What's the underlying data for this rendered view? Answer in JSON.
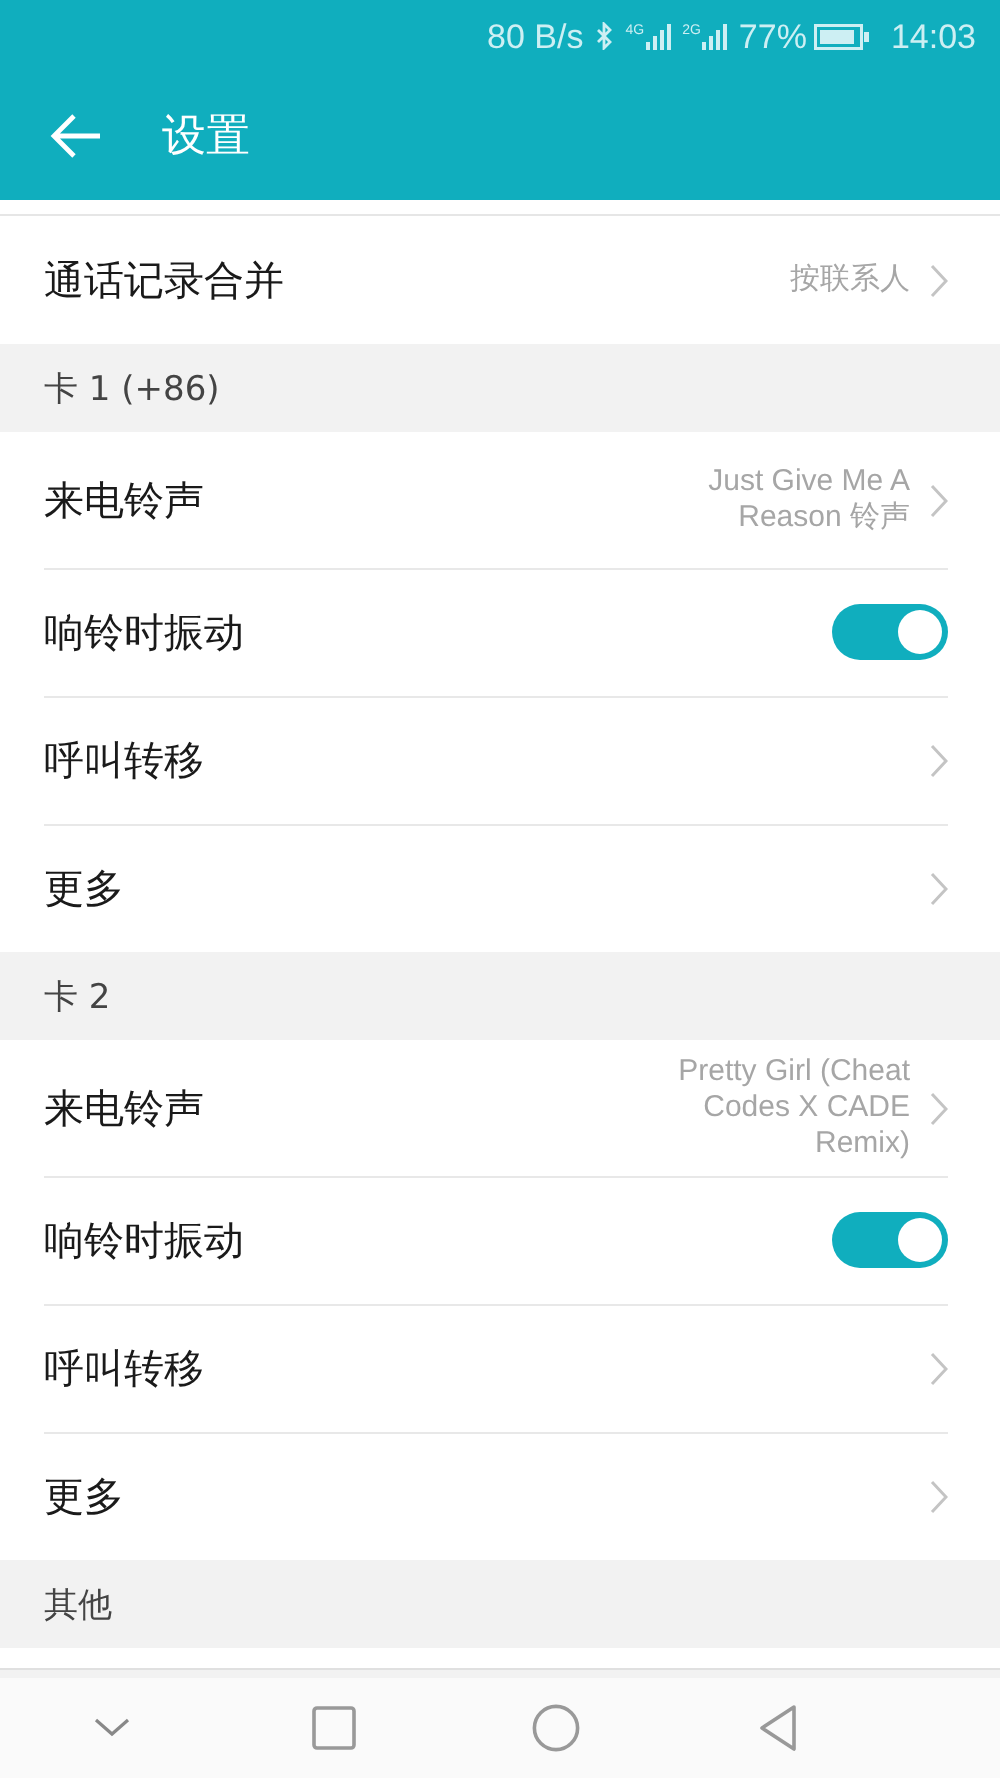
{
  "status_bar": {
    "speed": "80 B/s",
    "sim1_network": "4G",
    "sim2_network": "2G",
    "battery": "77%",
    "time": "14:03"
  },
  "app_bar": {
    "title": "设置"
  },
  "sections": [
    {
      "rows": [
        {
          "kind": "link",
          "label": "通话记录合并",
          "value": "按联系人"
        }
      ]
    },
    {
      "header": "卡 1 (+86)",
      "rows": [
        {
          "kind": "link",
          "label": "来电铃声",
          "value": "Just Give Me A Reason 铃声"
        },
        {
          "kind": "toggle",
          "label": "响铃时振动",
          "on": true
        },
        {
          "kind": "link",
          "label": "呼叫转移"
        },
        {
          "kind": "link",
          "label": "更多"
        }
      ]
    },
    {
      "header": "卡 2",
      "rows": [
        {
          "kind": "link",
          "label": "来电铃声",
          "value": "Pretty Girl (Cheat Codes X CADE Remix)"
        },
        {
          "kind": "toggle",
          "label": "响铃时振动",
          "on": true
        },
        {
          "kind": "link",
          "label": "呼叫转移"
        },
        {
          "kind": "link",
          "label": "更多"
        }
      ]
    },
    {
      "header": "其他"
    }
  ]
}
